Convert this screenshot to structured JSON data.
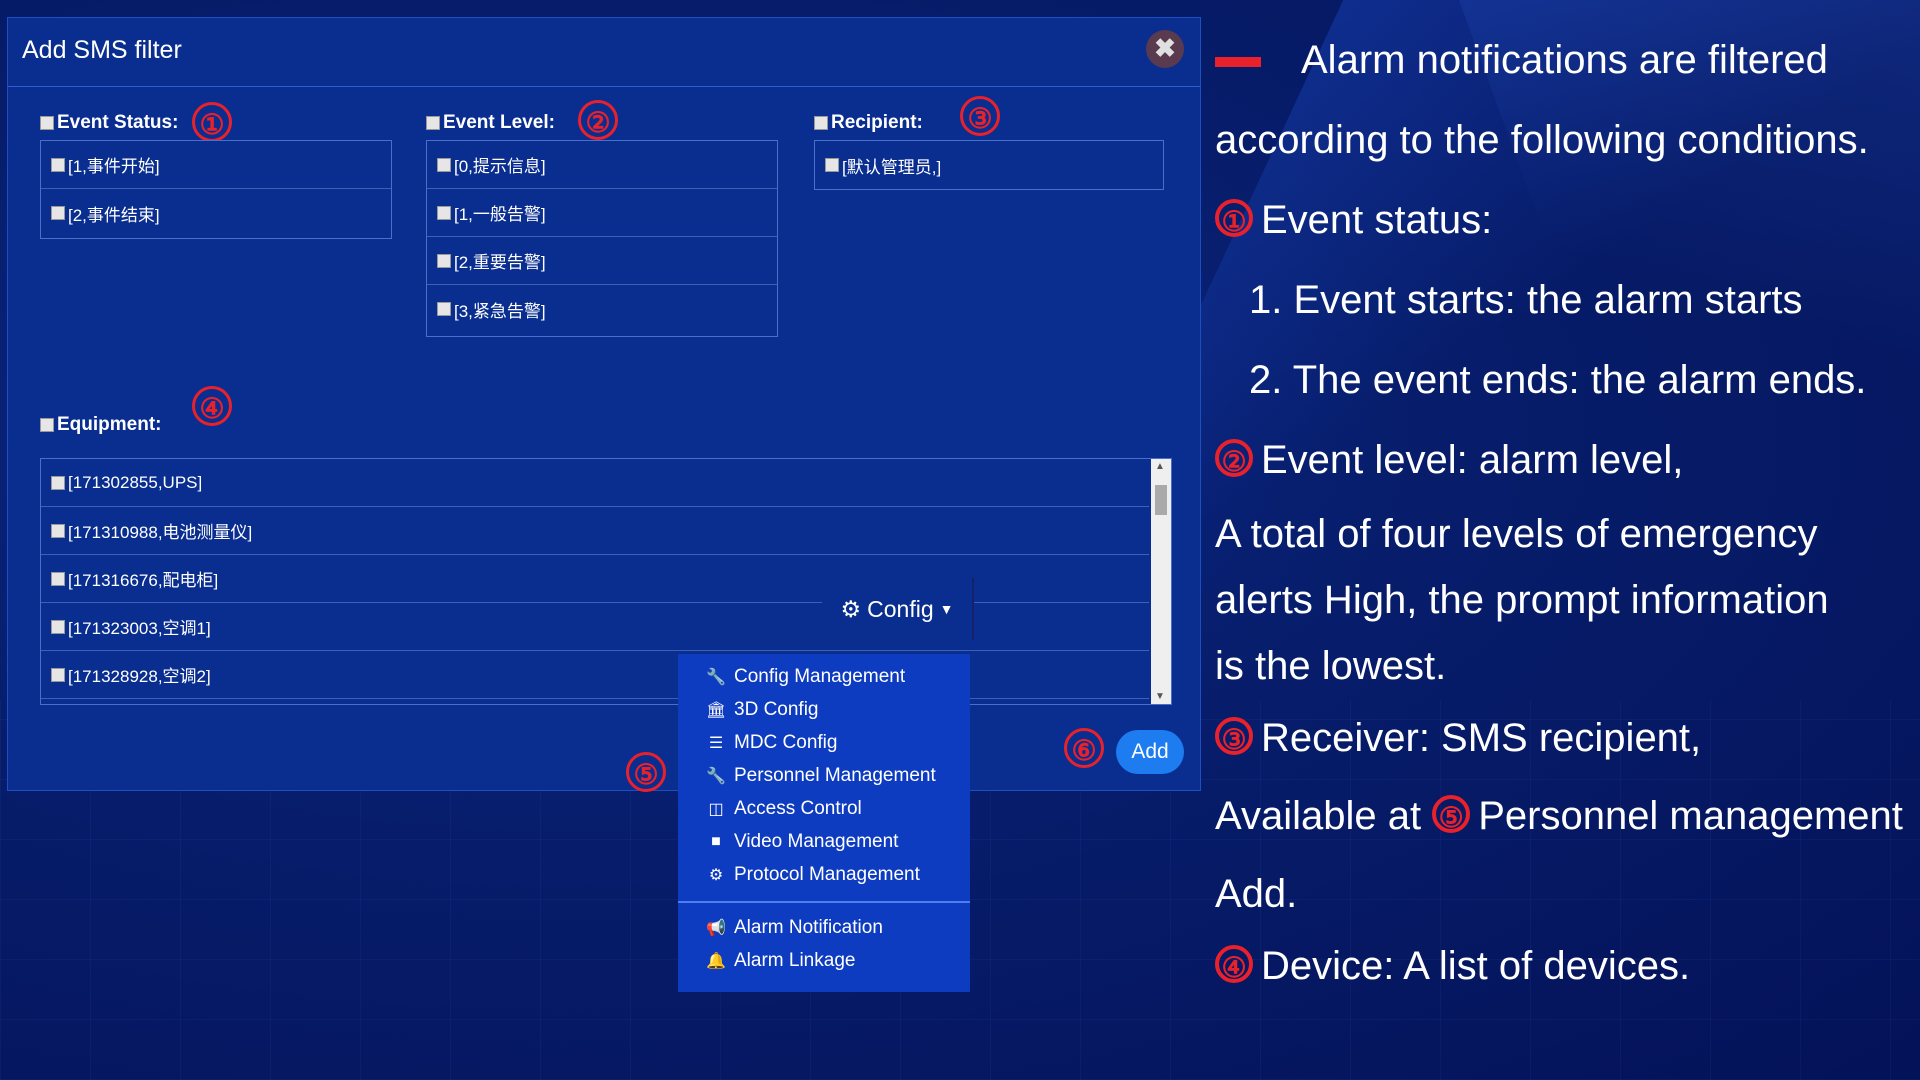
{
  "dialog": {
    "title": "Add SMS filter",
    "close_glyph": "✖",
    "add_label": "Add"
  },
  "filters": {
    "event_status": {
      "label": "Event Status:",
      "items": [
        "[1,事件开始]",
        "[2,事件结束]"
      ]
    },
    "event_level": {
      "label": "Event Level:",
      "items": [
        "[0,提示信息]",
        "[1,一般告警]",
        "[2,重要告警]",
        "[3,紧急告警]"
      ]
    },
    "recipient": {
      "label": "Recipient:",
      "items": [
        "[默认管理员,]"
      ]
    },
    "equipment": {
      "label": "Equipment:",
      "items": [
        "[171302855,UPS]",
        "[171310988,电池测量仪]",
        "[171316676,配电柜]",
        "[171323003,空调1]",
        "[171328928,空调2]"
      ]
    }
  },
  "config_menu": {
    "button_label": "Config",
    "items": [
      {
        "label": "Config Management",
        "icon": "wrench-icon"
      },
      {
        "label": "3D Config",
        "icon": "bank-icon"
      },
      {
        "label": "MDC Config",
        "icon": "list-icon"
      },
      {
        "label": "Personnel Management",
        "icon": "wrench-icon"
      },
      {
        "label": "Access Control",
        "icon": "columns-icon"
      },
      {
        "label": "Video Management",
        "icon": "video-camera-icon"
      },
      {
        "label": "Protocol Management",
        "icon": "cogs-icon"
      }
    ],
    "items2": [
      {
        "label": "Alarm Notification",
        "icon": "bullhorn-icon"
      },
      {
        "label": "Alarm Linkage",
        "icon": "bell-icon"
      }
    ]
  },
  "markers": [
    "①",
    "②",
    "③",
    "④",
    "⑤",
    "⑥"
  ],
  "notes": {
    "line1": "Alarm notifications are filtered",
    "line2": "according to the following conditions.",
    "line3": "Event status:",
    "line4": "1. Event starts: the alarm starts",
    "line5": "2. The event ends: the alarm ends.",
    "line6": "Event level: alarm level,",
    "line7": "A total of four levels of emergency",
    "line8": "alerts High, the prompt information",
    "line9": "is the lowest.",
    "line10": "Receiver: SMS recipient,",
    "line11a": "Available at",
    "line11b": "Personnel management",
    "line12": "Add.",
    "line13": "Device: A list of devices."
  },
  "colors": {
    "accent_red": "#e8212b",
    "dialog_bg": "#0a2e8f",
    "menu_bg": "#0e3cc0",
    "add_button": "#1d7cf0"
  }
}
